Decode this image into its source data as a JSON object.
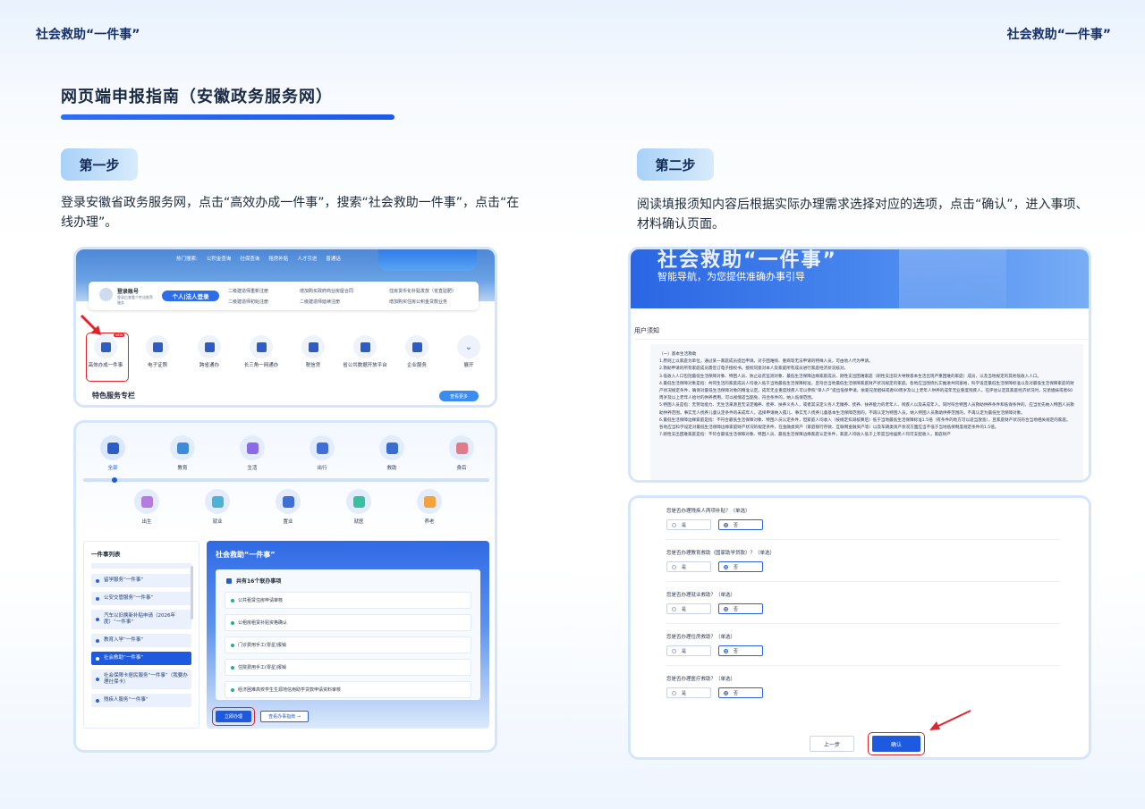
{
  "header": {
    "left": "社会救助“一件事”",
    "right": "社会救助“一件事”"
  },
  "title": "网页端申报指南（安徽政务服务网）",
  "steps": [
    {
      "tag": "第一步",
      "desc": "登录安徽省政务服务网，点击“高效办成一件事”，搜索“社会救助一件事”，点击“在线办理”。"
    },
    {
      "tag": "第二步",
      "desc": "阅读填报须知内容后根据实际办理需求选择对应的选项，点击“确认”，进入事项、材料确认页面。"
    }
  ],
  "shot1": {
    "nav": [
      "热门搜索:",
      "公积金查询",
      "社保查询",
      "租房补贴",
      "人才引进",
      "普通话"
    ],
    "login": "登录账号",
    "login_sub": "登录后查看个性化推荐服务",
    "portal": "个人|法人登录",
    "links": [
      "二级建造师重新注册",
      "二级建造师初始注册",
      "增加购买政府商业房屋合同",
      "二级建造师延续注册",
      "住房货币化补贴发放（省直驻肥）",
      "增加购买住房公积金贷款业务"
    ],
    "badge": "NEW",
    "services": [
      "高效办成一件事",
      "电子证照",
      "跨省通办",
      "长三角一网通办",
      "税信贷",
      "省公共数据开放平台",
      "企业服务",
      "展开"
    ],
    "special": "特色服务专栏",
    "more": "查看更多"
  },
  "shot2": {
    "row1": [
      "全部",
      "教育",
      "生活",
      "出行",
      "救助",
      "身后"
    ],
    "row2": [
      "出生",
      "就业",
      "置业",
      "就医",
      "养老"
    ],
    "list_title": "一件事列表",
    "list": [
      "留学服务“一件事”",
      "公安交管服务“一件事”",
      "汽车以旧换新补贴申请（2026年度）“一件事”",
      "教育入学“一件事”",
      "社会救助“一件事”",
      "社会保障卡居民服务“一件事”（我要办理社保卡）",
      "残疾人服务“一件事”"
    ],
    "panel_title": "社会救助“一件事”",
    "count": "共有16个联办事项",
    "items": [
      "公共租赁住房申请审核",
      "公租房租赁补贴资格确认",
      "门诊费用手工(零星)报销",
      "住院费用手工(零星)报销",
      "经济困难高校学生生源地信用助学贷款申请资料审核"
    ],
    "apply": "立即办理",
    "guide": "查看办事指南 →"
  },
  "shot3": {
    "banner_big": "社会救助“一件事”",
    "banner_sub": "智能导航，为您提供准确办事引导",
    "notice_title": "用户须知",
    "notice": [
      "（一）基本生活救助",
      "1.原则上以家庭为单位，通过某一家庭成员提出申请。对于困难残、重病等无法申请的特殊人员，可由他人代为申请。",
      "2.救助申请的所有家庭成员需签订电子授权书。授权同意对本人及家庭所有成员进行家庭经济状况核对。",
      "3.低收入人口包括最低生活保障对象、特困人员、防止返贫监测对象、最低生活保障边缘家庭成员、刚性支出困难家庭（刚性支出较大导致基本生活出现严重困难的家庭）成员，以及当地规定的其他低收入人口。",
      "4.最低生活保障对象是指：共同生活的家庭成员人均收入低于当地最低生活保障标准，且符合当地最低生活保障家庭财产状况规定的家庭。各地应当围绕扎实推进共同富裕，科学设定最低生活保障标准以及对最低生活保障家庭的财产状况规定条件，确保对最低生活保障对象的精准认定。成年无业重度残疾人可以参照“单人户”提出低保申请。依靠兄弟姐妹或者60周岁及以上老年人供养的成年无业重度残疾人，在评估认定其家庭经济状况时，兄弟姐妹或者60周岁及以上老年人给付的供养费用，可以视情适当豁免，符合条件的，纳入低保范围。",
      "5.特困人员是指：无劳动能力、无生活来源且无法定赡养、抚养、扶养义务人，或者其法定义务人无赡养、抚养、扶养能力的老年人、残疾人以及未成年人。同时符合特困人员救助供养条件和低保条件的，应当优先纳入特困人员救助供养范围。事实无人抚养儿童认定条件的未成年人，选择申请纳入孤儿、事实无人抚养儿童基本生活保障范围的，不再认定为特困人员。纳入特困人员救助供养范围的，不再认定为最低生活保障对象。",
      "6.最低生活保障边缘家庭是指：不符合最低生活保障对象、特困人员认定条件，但家庭人均收入（按规定扣减核算后）低于当地最低生活保障标准1.5倍（有条件的地方可以适当放宽），且家庭财产状况符合当地相关规定的家庭。各地应当科学设定对最低生活保障边缘家庭财产状况的规定条件，在金融类资产（家庭银行存款、互联网金融资产等）以及车辆类资产状况方面应当不低于当地低保制度规定条件的1.5倍。",
      "7.刚性支出困难家庭是指：不符合最低生活保障对象、特困人员、最低生活保障边缘家庭认定条件，家庭人均收入低于上年度当地居民人均可支配收入，家庭财产"
    ]
  },
  "shot4": {
    "questions": [
      "您是否办理残疾人两项补贴？（单选）",
      "您是否办理教育救助（国家助学贷款）？（单选）",
      "您是否办理就业救助？（单选）",
      "您是否办理住房救助？（单选）",
      "您是否办理医疗救助？（单选）"
    ],
    "yes": "是",
    "no": "否",
    "prev": "上一步",
    "confirm": "确认"
  },
  "colors": {
    "accent": "#1d5ae0",
    "highlight": "#e0242b",
    "tag_bg": "#b6d8f8"
  }
}
